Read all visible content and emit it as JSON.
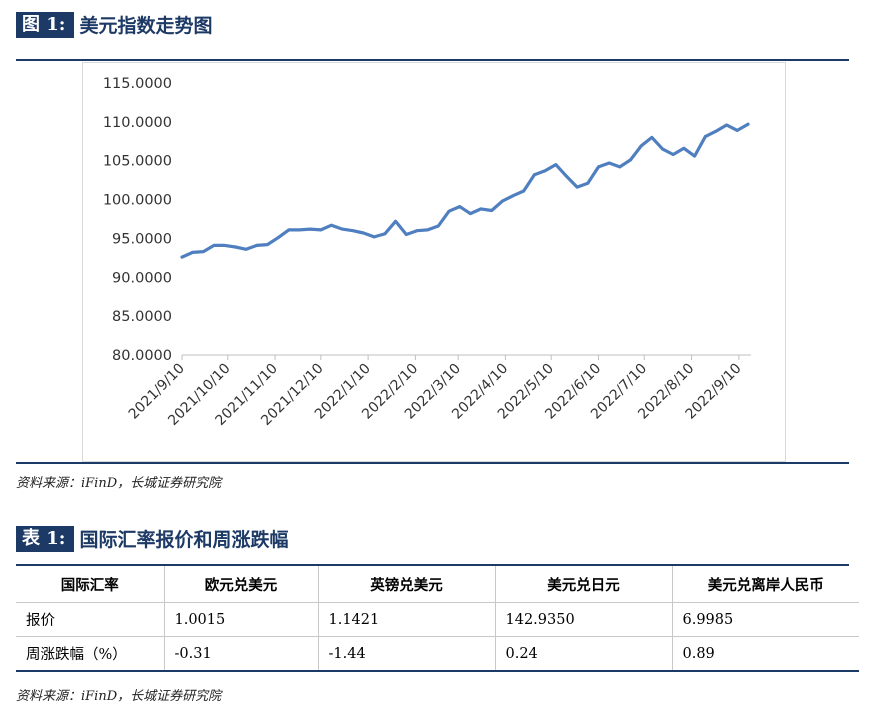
{
  "figure": {
    "tag": "图 1:",
    "title": "美元指数走势图",
    "source": "资料来源：iFinD，长城证券研究院"
  },
  "table": {
    "tag": "表 1:",
    "title": "国际汇率报价和周涨跌幅",
    "headers": [
      "国际汇率",
      "欧元兑美元",
      "英镑兑美元",
      "美元兑日元",
      "美元兑离岸人民币"
    ],
    "rows": [
      [
        "报价",
        "1.0015",
        "1.1421",
        "142.9350",
        "6.9985"
      ],
      [
        "周涨跌幅（%）",
        "-0.31",
        "-1.44",
        "0.24",
        "0.89"
      ]
    ],
    "source": "资料来源：iFinD，长城证券研究院"
  },
  "colors": {
    "accent": "#1d3a66",
    "line": "#4f7fbf"
  },
  "chart_data": {
    "type": "line",
    "title": "",
    "xlabel": "",
    "ylabel": "",
    "ylim": [
      80,
      115
    ],
    "yticks": [
      "80.0000",
      "85.0000",
      "90.0000",
      "95.0000",
      "100.0000",
      "105.0000",
      "110.0000",
      "115.0000"
    ],
    "xticks": [
      "2021/9/10",
      "2021/10/10",
      "2021/11/10",
      "2021/12/10",
      "2022/1/10",
      "2022/2/10",
      "2022/3/10",
      "2022/4/10",
      "2022/5/10",
      "2022/6/10",
      "2022/7/10",
      "2022/8/10",
      "2022/9/10"
    ],
    "grid": false,
    "x": [
      "2021/9/10",
      "2021/9/17",
      "2021/9/24",
      "2021/10/1",
      "2021/10/8",
      "2021/10/15",
      "2021/10/22",
      "2021/10/29",
      "2021/11/5",
      "2021/11/12",
      "2021/11/19",
      "2021/11/26",
      "2021/12/3",
      "2021/12/10",
      "2021/12/17",
      "2021/12/24",
      "2021/12/31",
      "2022/1/7",
      "2022/1/14",
      "2022/1/21",
      "2022/1/28",
      "2022/2/4",
      "2022/2/11",
      "2022/2/18",
      "2022/2/25",
      "2022/3/4",
      "2022/3/11",
      "2022/3/18",
      "2022/3/25",
      "2022/4/1",
      "2022/4/8",
      "2022/4/15",
      "2022/4/22",
      "2022/4/29",
      "2022/5/6",
      "2022/5/13",
      "2022/5/20",
      "2022/5/27",
      "2022/6/3",
      "2022/6/10",
      "2022/6/17",
      "2022/6/24",
      "2022/7/1",
      "2022/7/8",
      "2022/7/15",
      "2022/7/22",
      "2022/7/29",
      "2022/8/5",
      "2022/8/12",
      "2022/8/19",
      "2022/8/26",
      "2022/9/2",
      "2022/9/9",
      "2022/9/16"
    ],
    "series": [
      {
        "values": [
          92.6,
          93.2,
          93.3,
          94.1,
          94.1,
          93.9,
          93.6,
          94.1,
          94.2,
          95.1,
          96.1,
          96.1,
          96.2,
          96.1,
          96.7,
          96.2,
          96.0,
          95.7,
          95.2,
          95.6,
          97.2,
          95.5,
          96.0,
          96.1,
          96.6,
          98.5,
          99.1,
          98.2,
          98.8,
          98.6,
          99.8,
          100.5,
          101.1,
          103.2,
          103.7,
          104.5,
          103.0,
          101.6,
          102.1,
          104.2,
          104.7,
          104.2,
          105.1,
          106.9,
          108.0,
          106.5,
          105.8,
          106.6,
          105.6,
          108.1,
          108.8,
          109.6,
          108.9,
          109.7
        ]
      }
    ]
  }
}
